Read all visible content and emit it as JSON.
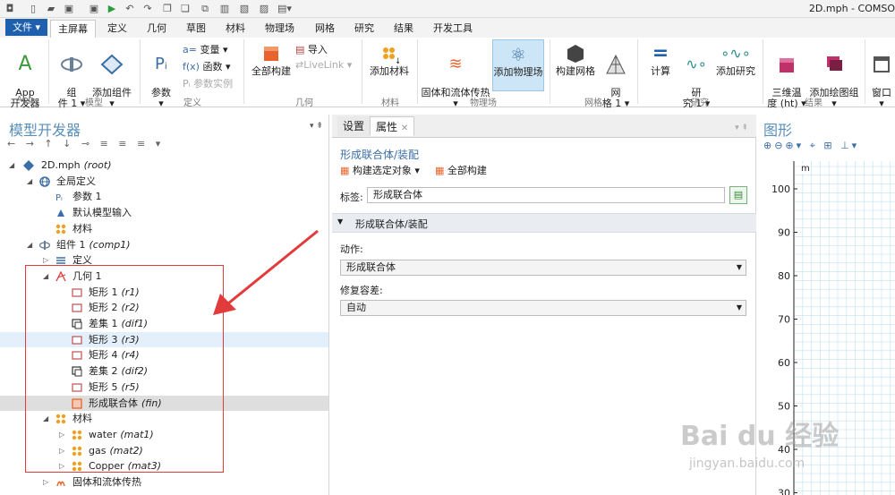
{
  "titlebar": {
    "window_title": "2D.mph - COMSO"
  },
  "ribbon_tabs": {
    "file": "文件 ▾",
    "home": "主屏幕",
    "definitions": "定义",
    "geometry": "几何",
    "sketch": "草图",
    "materials": "材料",
    "physics": "物理场",
    "mesh": "网格",
    "study": "研究",
    "results": "结果",
    "developer": "开发工具"
  },
  "ribbon": {
    "app_developer": "App\n开发器",
    "component": "组\n件 1 ▾",
    "add_component": "添加组件\n▾",
    "parameters": "参数\n▾",
    "variables": "变量 ▾",
    "functions": "函数 ▾",
    "param_instance": "参数实例",
    "build_all": "全部构建",
    "import": "导入",
    "livelink": "LiveLink ▾",
    "add_material": "添加材料",
    "heat_transfer": "固体和流体传热\n▾",
    "add_physics": "添加物理场",
    "build_mesh": "构建网格",
    "mesh1": "网\n格 1 ▾",
    "compute": "计算",
    "study1": "研\n究 1 ▾",
    "add_study": "添加研究",
    "temp3d": "三维温\n度 (ht) ▾",
    "add_plot_group": "添加绘图组\n▾",
    "window": "窗口\n▾",
    "groups": {
      "app": "App",
      "model": "模型",
      "definitions": "定义",
      "geometry": "几何",
      "materials": "材料",
      "physics": "物理场",
      "mesh": "网格",
      "study": "研究",
      "results": "结果"
    }
  },
  "left_panel": {
    "title": "模型开发器",
    "toolbar_glyphs": "← → ↑ ↓ ⊸ ≡ ≡ ≡ ▾"
  },
  "tree": [
    {
      "label": "2D.mph",
      "tag": "(root)"
    },
    {
      "label": "全局定义",
      "tag": ""
    },
    {
      "label": "参数 1",
      "tag": ""
    },
    {
      "label": "默认模型输入",
      "tag": ""
    },
    {
      "label": "材料",
      "tag": ""
    },
    {
      "label": "组件 1",
      "tag": "(comp1)"
    },
    {
      "label": "定义",
      "tag": ""
    },
    {
      "label": "几何 1",
      "tag": ""
    },
    {
      "label": "矩形 1",
      "tag": "(r1)"
    },
    {
      "label": "矩形 2",
      "tag": "(r2)"
    },
    {
      "label": "差集 1",
      "tag": "(dif1)"
    },
    {
      "label": "矩形 3",
      "tag": "(r3)"
    },
    {
      "label": "矩形 4",
      "tag": "(r4)"
    },
    {
      "label": "差集 2",
      "tag": "(dif2)"
    },
    {
      "label": "矩形 5",
      "tag": "(r5)"
    },
    {
      "label": "形成联合体",
      "tag": "(fin)"
    },
    {
      "label": "材料",
      "tag": ""
    },
    {
      "label": "water",
      "tag": "(mat1)"
    },
    {
      "label": "gas",
      "tag": "(mat2)"
    },
    {
      "label": "Copper",
      "tag": "(mat3)"
    },
    {
      "label": "固体和流体传热",
      "tag": ""
    }
  ],
  "middle_panel": {
    "tab_settings": "设置",
    "tab_properties": "属性",
    "heading": "形成联合体/装配",
    "build_selected": "构建选定对象",
    "build_all": "全部构建",
    "label_caption": "标签:",
    "label_value": "形成联合体",
    "section_title": "形成联合体/装配",
    "action_caption": "动作:",
    "action_value": "形成联合体",
    "repair_caption": "修复容差:",
    "repair_value": "自动"
  },
  "graphics_panel": {
    "title": "图形",
    "unit": "m",
    "y_ticks": [
      "100",
      "90",
      "80",
      "70",
      "60",
      "50",
      "40",
      "30"
    ]
  },
  "watermark": {
    "text1": "Bai du 经验",
    "text2": "jingyan.baidu.com"
  },
  "colors": {
    "accent_blue": "#1e5fae",
    "annotation_red": "#e23b3b",
    "selected_physics": "#cde6f7",
    "grid": "#bfe0f2"
  }
}
